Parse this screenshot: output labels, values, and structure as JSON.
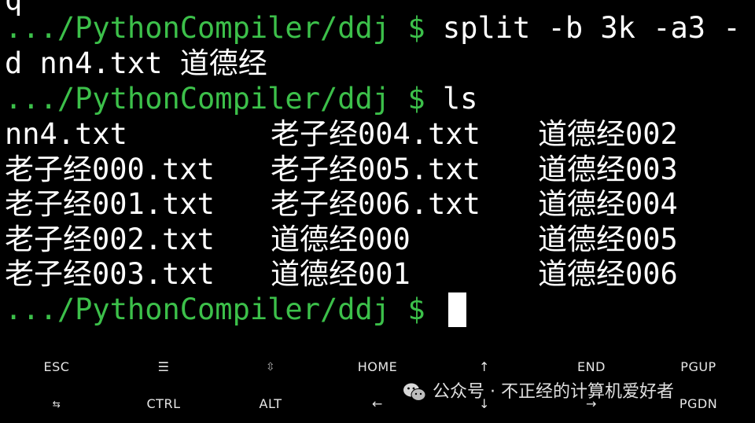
{
  "terminal": {
    "partial_top": "q",
    "prompt": ".../PythonCompiler/ddj $",
    "command1_line1": " split -b 3k -a3 -",
    "command1_line2": "d nn4.txt 道德经",
    "command2": " ls",
    "ls_rows": [
      [
        "nn4.txt",
        "老子经004.txt",
        "道德经002"
      ],
      [
        "老子经000.txt",
        "老子经005.txt",
        "道德经003"
      ],
      [
        "老子经001.txt",
        "老子经006.txt",
        "道德经004"
      ],
      [
        "老子经002.txt",
        "道德经000",
        "道德经005"
      ],
      [
        "老子经003.txt",
        "道德经001",
        "道德经006"
      ]
    ],
    "final_prompt": ".../PythonCompiler/ddj $"
  },
  "extra_keys": {
    "row1": [
      "ESC",
      "☰",
      "⇳",
      "HOME",
      "↑",
      "END",
      "PGUP"
    ],
    "row2": [
      "⇆",
      "CTRL",
      "ALT",
      "←",
      "↓",
      "→",
      "PGDN"
    ]
  },
  "watermark": {
    "text": "公众号 · 不正经的计算机爱好者",
    "icon": "wechat-icon"
  },
  "colors": {
    "prompt": "#3cc04a",
    "text": "#ffffff",
    "background": "#000000"
  }
}
